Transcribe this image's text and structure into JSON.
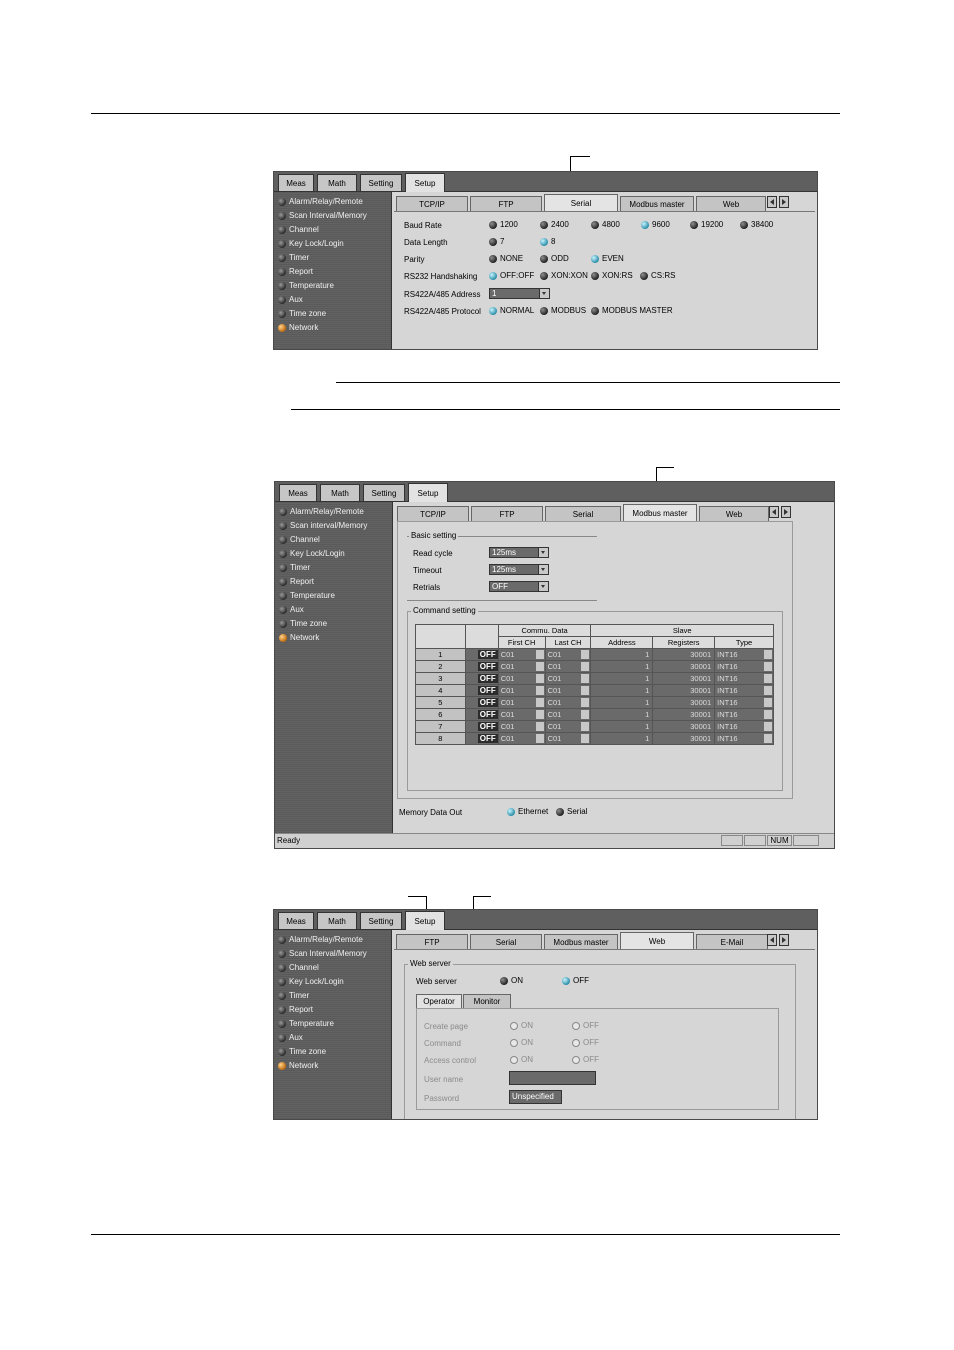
{
  "top_tabs": [
    "Meas",
    "Math",
    "Setting",
    "Setup"
  ],
  "sidebar_items": [
    "Alarm/Relay/Remote",
    "Scan Interval/Memory",
    "Channel",
    "Key Lock/Login",
    "Timer",
    "Report",
    "Temperature",
    "Aux",
    "Time zone",
    "Network"
  ],
  "sidebar_items_shot2": [
    "Alarm/Relay/Remote",
    "Scan interval/Memory",
    "Channel",
    "Key Lock/Login",
    "Timer",
    "Report",
    "Temperature",
    "Aux",
    "Time zone",
    "Network"
  ],
  "shot1": {
    "subtabs": [
      "TCP/IP",
      "FTP",
      "Serial",
      "Modbus master",
      "Web"
    ],
    "baud_label": "Baud Rate",
    "baud": [
      "1200",
      "2400",
      "4800",
      "9600",
      "19200",
      "38400"
    ],
    "length_label": "Data Length",
    "length": [
      "7",
      "8"
    ],
    "parity_label": "Parity",
    "parity": [
      "NONE",
      "ODD",
      "EVEN"
    ],
    "handshake_label": "RS232 Handshaking",
    "handshake": [
      "OFF:OFF",
      "XON:XON",
      "XON:RS",
      "CS:RS"
    ],
    "address_label": "RS422A/485 Address",
    "address_value": "1",
    "protocol_label": "RS422A/485 Protocol",
    "protocol": [
      "NORMAL",
      "MODBUS",
      "MODBUS MASTER"
    ]
  },
  "shot2": {
    "subtabs": [
      "TCP/IP",
      "FTP",
      "Serial",
      "Modbus master",
      "Web"
    ],
    "basic_title": "Basic setting",
    "read_cycle_label": "Read cycle",
    "read_cycle": "125ms",
    "timeout_label": "Timeout",
    "timeout": "125ms",
    "retrials_label": "Retrials",
    "retrials": "OFF",
    "command_title": "Command setting",
    "group_commu": "Commu. Data",
    "group_slave": "Slave",
    "col_first": "First CH",
    "col_last": "Last CH",
    "col_address": "Address",
    "col_registers": "Registers",
    "col_type": "Type",
    "off_label": "OFF",
    "row_first": "C01",
    "row_last": "C01",
    "row_address": "1",
    "row_registers": "30001",
    "row_type": "INT16",
    "rows": [
      "1",
      "2",
      "3",
      "4",
      "5",
      "6",
      "7",
      "8"
    ],
    "memory_label": "Memory Data Out",
    "memory_opts": [
      "Ethernet",
      "Serial"
    ],
    "status_ready": "Ready",
    "status_num": "NUM"
  },
  "shot3": {
    "subtabs": [
      "FTP",
      "Serial",
      "Modbus master",
      "Web",
      "E-Mail"
    ],
    "web_title": "Web server",
    "web_label": "Web server",
    "web_opts": [
      "ON",
      "OFF"
    ],
    "inner_tabs": [
      "Operator",
      "Monitor"
    ],
    "create_label": "Create page",
    "command_label": "Command",
    "access_label": "Access control",
    "on_text": "ON",
    "off_text": "OFF",
    "user_label": "User name",
    "password_label": "Password",
    "password_value": "Unspecified"
  }
}
